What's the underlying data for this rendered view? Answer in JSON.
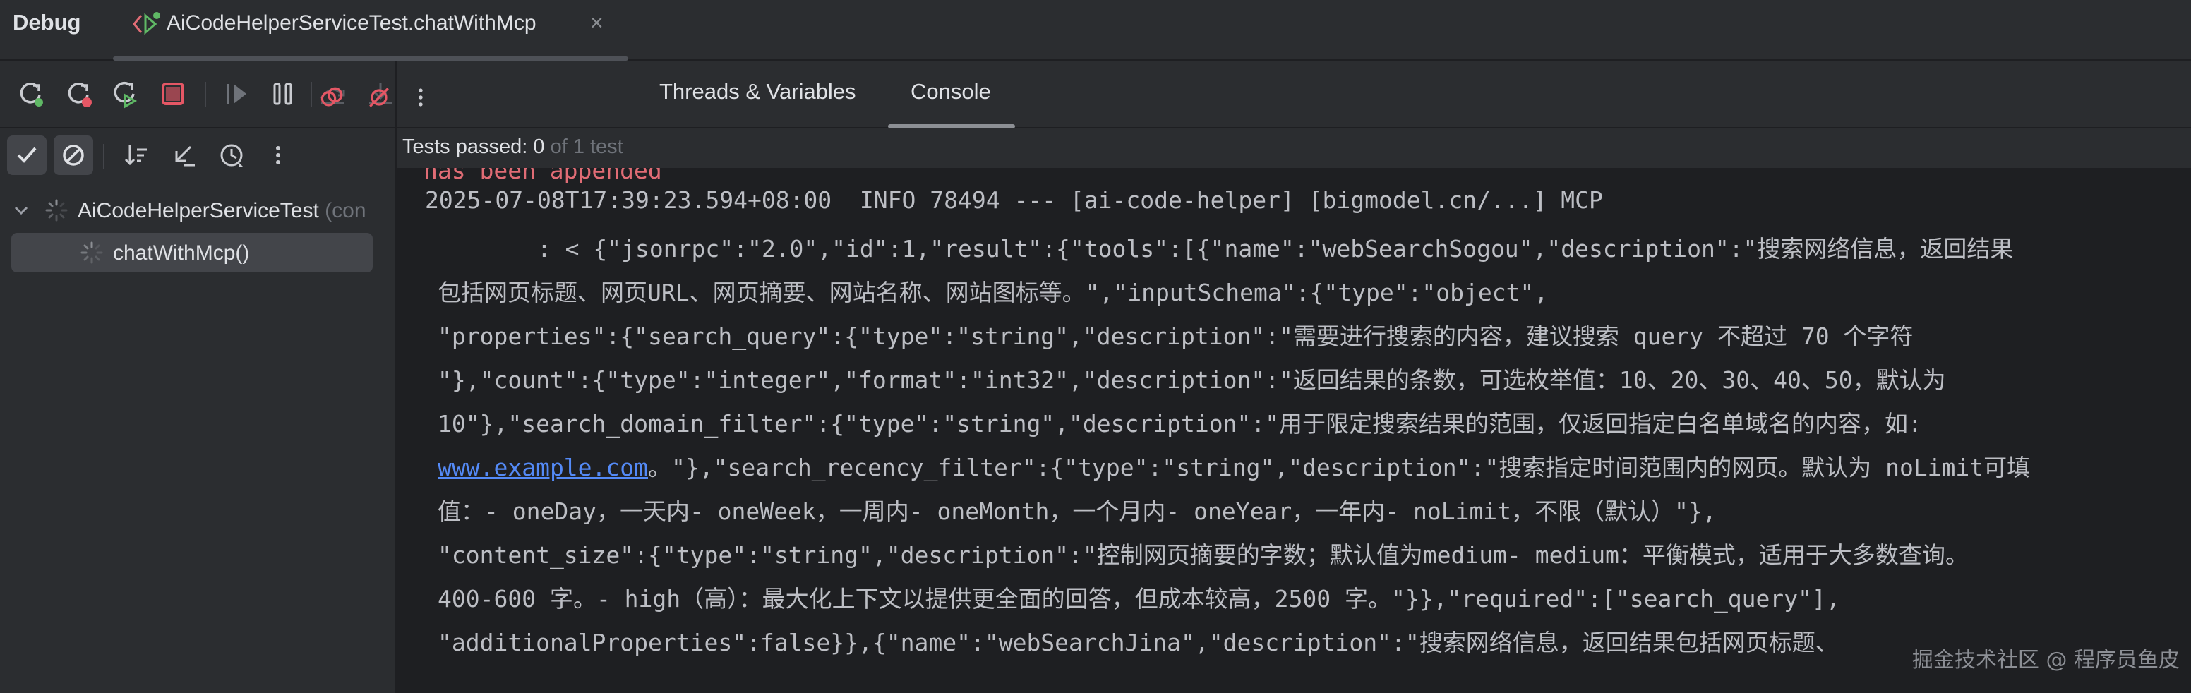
{
  "window": {
    "panel_title": "Debug",
    "run_tab": {
      "label": "AiCodeHelperServiceTest.chatWithMcp",
      "close": "×"
    }
  },
  "toolbar": {
    "icons": [
      "rerun-icon",
      "rerun-failed-icon",
      "rerun-auto-icon",
      "stop-icon",
      "resume-icon",
      "pause-icon",
      "step-over-icon",
      "step-into-icon",
      "step-out-icon",
      "view-breakpoints-icon",
      "mute-breakpoints-icon",
      "more-options-icon"
    ]
  },
  "tabs": [
    {
      "label": "Threads & Variables"
    },
    {
      "label": "Console"
    }
  ],
  "test_toolbar": {
    "icons": [
      "show-passed-icon",
      "show-ignored-icon",
      "sort-icon",
      "collapse-icon",
      "history-icon",
      "more-icon"
    ]
  },
  "test_tree": {
    "root": {
      "label": "AiCodeHelperServiceTest",
      "suffix": "(con"
    },
    "child": {
      "label": "chatWithMcp()"
    }
  },
  "status": {
    "prefix": "Tests passed: ",
    "count": "0",
    "suffix": " of 1 test"
  },
  "console": {
    "lines": [
      {
        "text": "has been appended",
        "style": "red"
      },
      {
        "text": "2025-07-08T17:39:23.594+08:00  INFO 78494 --- [ai-code-helper] [bigmodel.cn/...] MCP"
      },
      {
        "text": "        : < {\"jsonrpc\":\"2.0\",\"id\":1,\"result\":{\"tools\":[{\"name\":\"webSearchSogou\",\"description\":\"搜索网络信息，返回结果"
      },
      {
        "text": "包括网页标题、网页URL、网页摘要、网站名称、网站图标等。\",\"inputSchema\":{\"type\":\"object\",",
        "indent": true
      },
      {
        "text": "\"properties\":{\"search_query\":{\"type\":\"string\",\"description\":\"需要进行搜索的内容，建议搜索 query 不超过 70 个字符",
        "indent": true
      },
      {
        "text": "\"},\"count\":{\"type\":\"integer\",\"format\":\"int32\",\"description\":\"返回结果的条数，可选枚举值：10、20、30、40、50，默认为",
        "indent": true
      },
      {
        "text": "10\"},\"search_domain_filter\":{\"type\":\"string\",\"description\":\"用于限定搜索结果的范围，仅返回指定白名单域名的内容，如:",
        "indent": true
      },
      {
        "link": "www.example.com",
        "text": "。\"},\"search_recency_filter\":{\"type\":\"string\",\"description\":\"搜索指定时间范围内的网页。默认为 noLimit可填",
        "indent": true
      },
      {
        "text": "值：- oneDay，一天内- oneWeek，一周内- oneMonth，一个月内- oneYear，一年内- noLimit，不限（默认）\"},",
        "indent": true
      },
      {
        "text": "\"content_size\":{\"type\":\"string\",\"description\":\"控制网页摘要的字数；默认值为medium- medium：平衡模式，适用于大多数查询。",
        "indent": true
      },
      {
        "text": "400-600 字。- high（高）：最大化上下文以提供更全面的回答，但成本较高，2500 字。\"}},\"required\":[\"search_query\"],",
        "indent": true
      },
      {
        "text": "\"additionalProperties\":false}},{\"name\":\"webSearchJina\",\"description\":\"搜索网络信息，返回结果包括网页标题、",
        "indent": true
      }
    ]
  },
  "watermark": "掘金技术社区 @ 程序员鱼皮"
}
